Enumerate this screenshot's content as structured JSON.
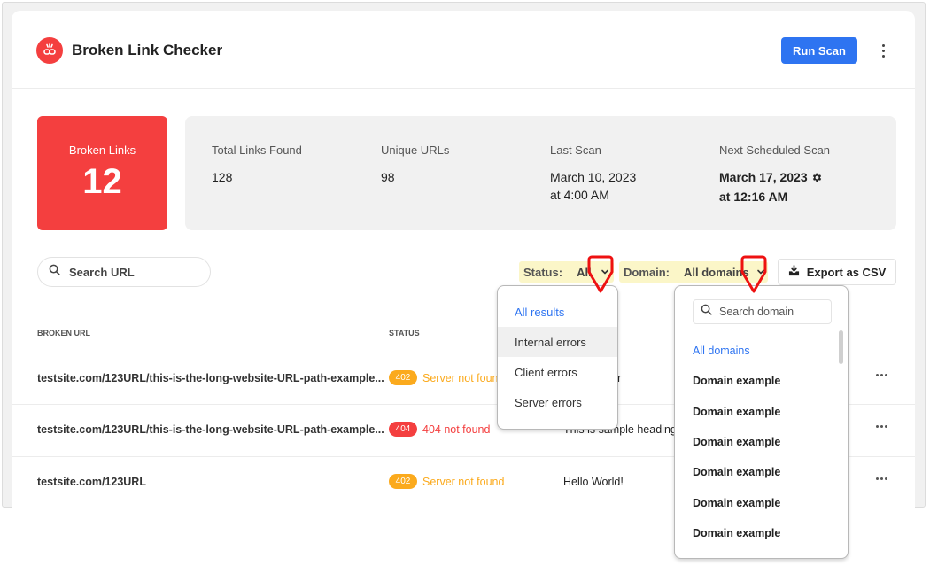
{
  "app": {
    "title": "Broken Link Checker",
    "logo_icon": "broken-link-icon",
    "brand_color": "#f43f3f",
    "accent_color": "#2e74f1"
  },
  "header": {
    "run_scan_label": "Run Scan",
    "more_icon": "kebab-menu-icon"
  },
  "stats": {
    "broken_links": {
      "label": "Broken Links",
      "value": "12"
    },
    "total_links": {
      "label": "Total Links Found",
      "value": "128"
    },
    "unique_urls": {
      "label": "Unique URLs",
      "value": "98"
    },
    "last_scan": {
      "label": "Last Scan",
      "date": "March 10, 2023",
      "time": "at 4:00 AM"
    },
    "next_scan": {
      "label": "Next Scheduled Scan",
      "date": "March 17, 2023",
      "time": "at 12:16 AM",
      "icon": "gear-icon"
    }
  },
  "toolbar": {
    "search_placeholder": "Search URL",
    "status_filter": {
      "label": "Status:",
      "value": "All"
    },
    "domain_filter": {
      "label": "Domain:",
      "value": "All domains"
    },
    "filter_highlight_color": "#fbf6c8",
    "export_label": "Export as CSV"
  },
  "table": {
    "columns": [
      "BROKEN URL",
      "STATUS"
    ],
    "rows": [
      {
        "url": "testsite.com/123URL/this-is-the-long-website-URL-path-example...",
        "code": "402",
        "status": "Server not found",
        "status_color": "#fbaa1d",
        "page": "Commenter"
      },
      {
        "url": "testsite.com/123URL/this-is-the-long-website-URL-path-example...",
        "code": "404",
        "status": "404 not found",
        "status_color": "#f43f3f",
        "page": "This is sample heading"
      },
      {
        "url": "testsite.com/123URL",
        "code": "402",
        "status": "Server not found",
        "status_color": "#fbaa1d",
        "page": "Hello World!"
      }
    ]
  },
  "status_dropdown": {
    "options": [
      "All results",
      "Internal errors",
      "Client errors",
      "Server errors"
    ],
    "selected": "All results",
    "hovered": "Internal errors"
  },
  "domain_dropdown": {
    "search_placeholder": "Search domain",
    "options": [
      "All domains",
      "Domain example",
      "Domain example",
      "Domain example",
      "Domain example",
      "Domain example",
      "Domain example",
      "Domain example"
    ],
    "selected": "All domains"
  }
}
